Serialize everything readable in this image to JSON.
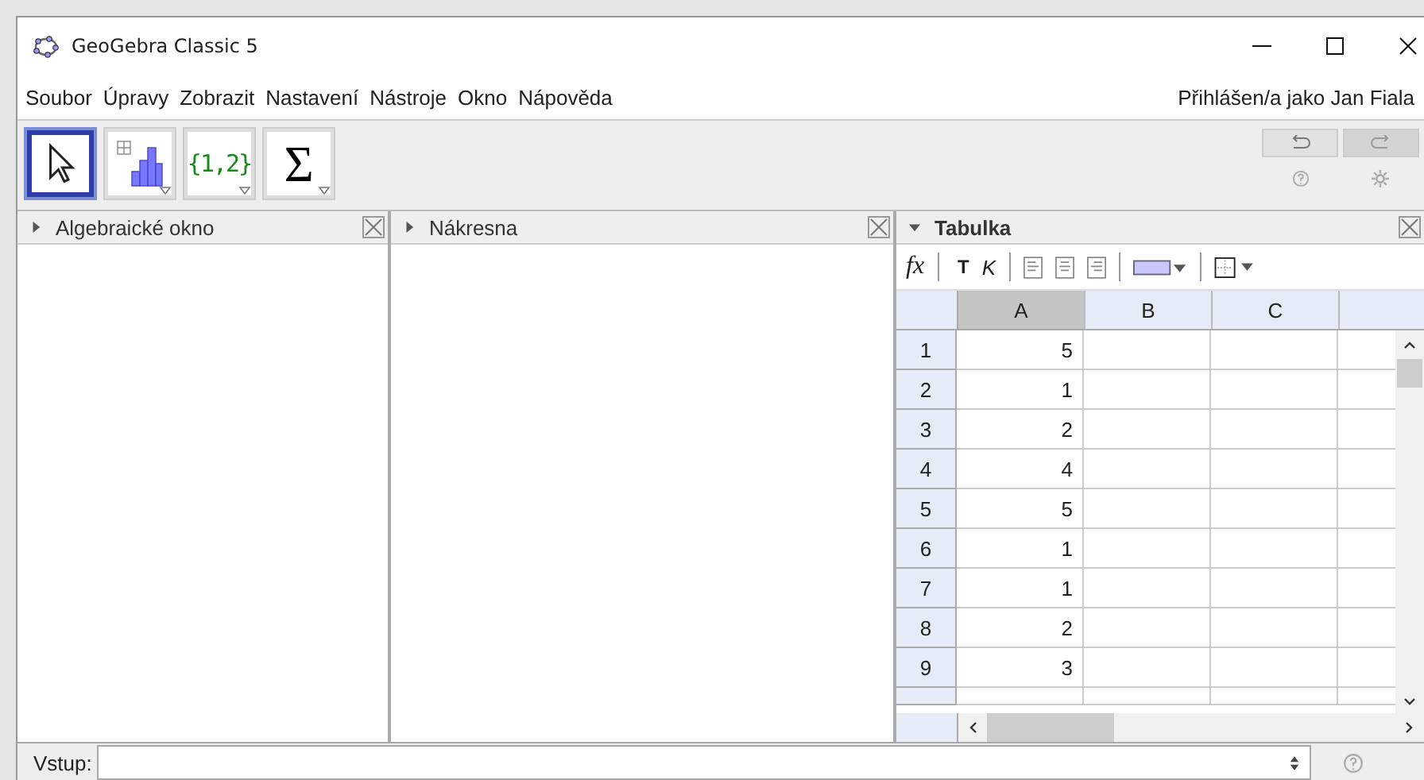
{
  "window": {
    "title": "GeoGebra Classic 5"
  },
  "menu": [
    "Soubor",
    "Úpravy",
    "Zobrazit",
    "Nastavení",
    "Nástroje",
    "Okno",
    "Nápověda"
  ],
  "user_label": "Přihlášen/a jako Jan Fiala",
  "tools": [
    {
      "kind": "move",
      "selected": true
    },
    {
      "kind": "histogram",
      "selected": false
    },
    {
      "kind": "list",
      "label": "{1,2}",
      "selected": false
    },
    {
      "kind": "sum",
      "label": "Σ",
      "selected": false
    }
  ],
  "panels": [
    {
      "title": "Algebraické okno",
      "expanded": false,
      "focused": false
    },
    {
      "title": "Nákresna",
      "expanded": false,
      "focused": false
    },
    {
      "title": "Tabulka",
      "expanded": true,
      "focused": true
    }
  ],
  "spreadsheet": {
    "toolbar": {
      "formula": "fx",
      "bold": "T",
      "italic": "K"
    },
    "columns": [
      {
        "label": "A",
        "selected": true
      },
      {
        "label": "B",
        "selected": false
      },
      {
        "label": "C",
        "selected": false
      }
    ],
    "rows": [
      {
        "header": "1",
        "value": "5"
      },
      {
        "header": "2",
        "value": "1"
      },
      {
        "header": "3",
        "value": "2"
      },
      {
        "header": "4",
        "value": "4"
      },
      {
        "header": "5",
        "value": "5"
      },
      {
        "header": "6",
        "value": "1"
      },
      {
        "header": "7",
        "value": "1"
      },
      {
        "header": "8",
        "value": "2"
      },
      {
        "header": "9",
        "value": "3"
      }
    ]
  },
  "input_bar": {
    "label": "Vstup:"
  }
}
